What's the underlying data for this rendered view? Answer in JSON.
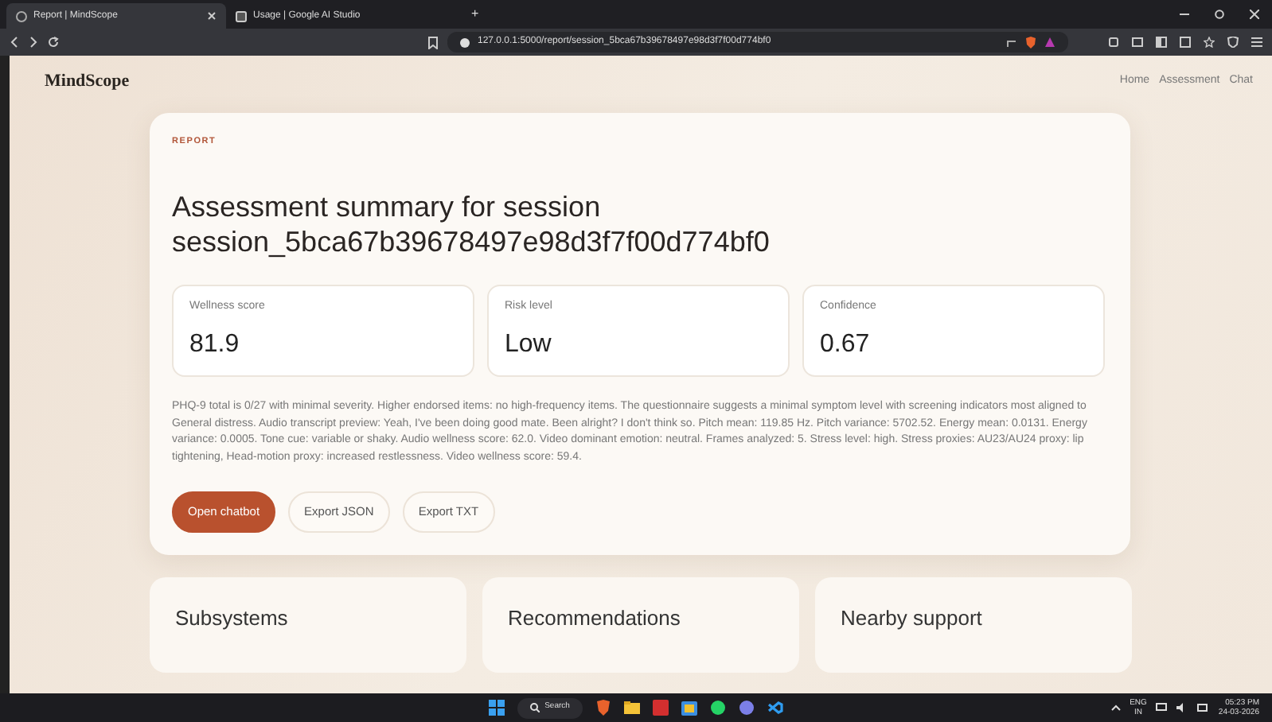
{
  "browser": {
    "tabs": [
      {
        "title": "Report | MindScope",
        "selected": true
      },
      {
        "title": "Usage | Google AI Studio",
        "selected": false
      }
    ],
    "new_tab": "+",
    "address": "127.0.0.1:5000/report/session_5bca67b39678497e98d3f7f00d774bf0"
  },
  "site": {
    "brand": "MindScope",
    "nav": [
      "Home",
      "Assessment",
      "Chat"
    ]
  },
  "report": {
    "eyebrow": "REPORT",
    "title": "Assessment summary for session session_5bca67b39678497e98d3f7f00d774bf0",
    "metrics": [
      {
        "label": "Wellness score",
        "value": "81.9"
      },
      {
        "label": "Risk level",
        "value": "Low"
      },
      {
        "label": "Confidence",
        "value": "0.67"
      }
    ],
    "summary": "PHQ-9 total is 0/27 with minimal severity. Higher endorsed items: no high-frequency items. The questionnaire suggests a minimal symptom level with screening indicators most aligned to General distress. Audio transcript preview: Yeah, I've been doing good mate. Been alright? I don't think so. Pitch mean: 119.85 Hz. Pitch variance: 5702.52. Energy mean: 0.0131. Energy variance: 0.0005. Tone cue: variable or shaky. Audio wellness score: 62.0. Video dominant emotion: neutral. Frames analyzed: 5. Stress level: high. Stress proxies: AU23/AU24 proxy: lip tightening, Head-motion proxy: increased restlessness. Video wellness score: 59.4.",
    "buttons": [
      {
        "label": "Open chatbot",
        "kind": "primary"
      },
      {
        "label": "Export JSON",
        "kind": "outline"
      },
      {
        "label": "Export TXT",
        "kind": "outline"
      }
    ]
  },
  "sections": [
    "Subsystems",
    "Recommendations",
    "Nearby support"
  ],
  "taskbar": {
    "search": "Search",
    "language": "ENG",
    "region": "IN",
    "time": "05:23 PM",
    "date": "24-03-2026"
  }
}
